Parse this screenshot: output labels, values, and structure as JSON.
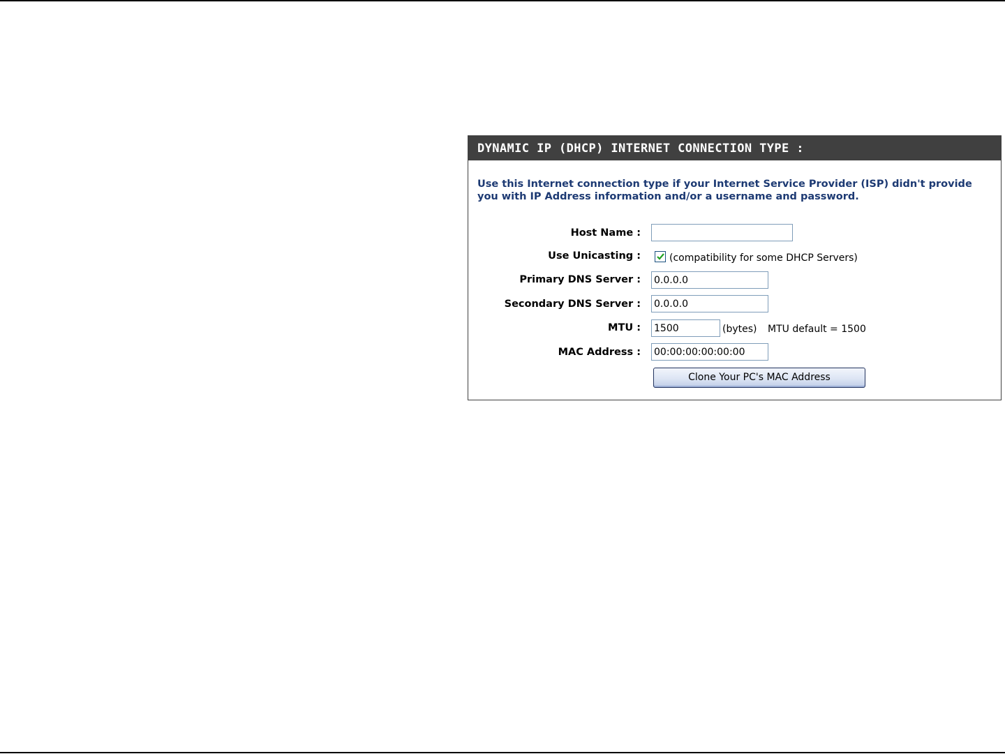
{
  "panel": {
    "title": "DYNAMIC IP (DHCP) INTERNET CONNECTION TYPE :",
    "description": "Use this Internet connection type if your Internet Service Provider (ISP) didn't provide you with IP Address information and/or a username and password."
  },
  "form": {
    "host_name": {
      "label": "Host Name :",
      "value": ""
    },
    "use_unicasting": {
      "label": "Use Unicasting :",
      "checked": true,
      "hint": "(compatibility for some DHCP Servers)"
    },
    "primary_dns": {
      "label": "Primary DNS Server :",
      "value": "0.0.0.0"
    },
    "secondary_dns": {
      "label": "Secondary DNS Server :",
      "value": "0.0.0.0"
    },
    "mtu": {
      "label": "MTU :",
      "value": "1500",
      "unit": "(bytes)",
      "default_text": "MTU default = 1500"
    },
    "mac_address": {
      "label": "MAC Address :",
      "value": "00:00:00:00:00:00"
    },
    "clone_button_label": "Clone Your PC's MAC Address"
  },
  "colors": {
    "header_bg": "#404040",
    "description_text": "#1d3a73",
    "input_border": "#7f9db9"
  }
}
